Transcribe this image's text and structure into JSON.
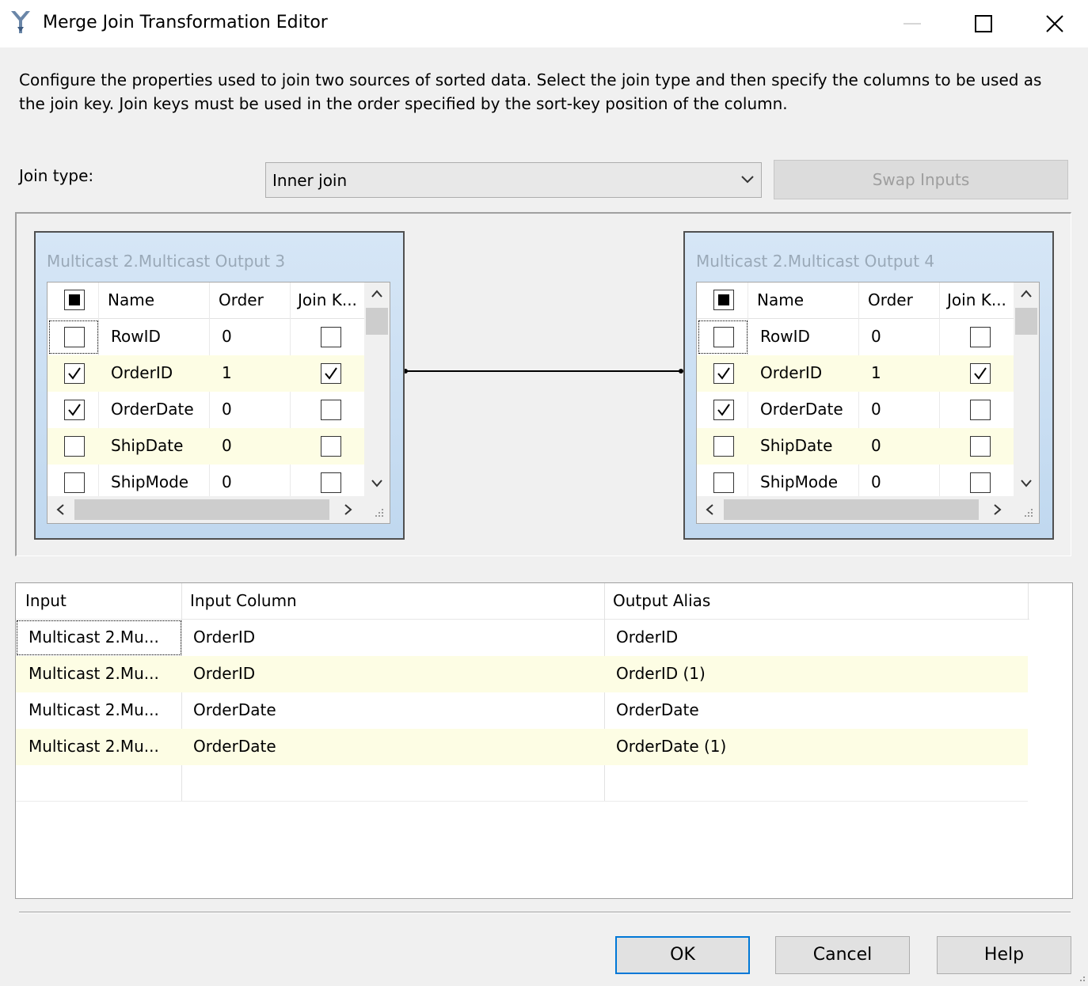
{
  "window": {
    "title": "Merge Join Transformation Editor"
  },
  "description": "Configure the properties used to join two sources of sorted data. Select the join type and then specify the columns to be used as the join key. Join keys must be used in the order specified by the sort-key position of the column.",
  "join": {
    "label": "Join type:",
    "selected": "Inner join",
    "swap_label": "Swap Inputs"
  },
  "left_input": {
    "title": "Multicast 2.Multicast Output 3",
    "headers": {
      "name": "Name",
      "order": "Order",
      "join_key": "Join K..."
    },
    "rows": [
      {
        "selected": false,
        "name": "RowID",
        "order": "0",
        "join_key": false
      },
      {
        "selected": true,
        "name": "OrderID",
        "order": "1",
        "join_key": true
      },
      {
        "selected": true,
        "name": "OrderDate",
        "order": "0",
        "join_key": false
      },
      {
        "selected": false,
        "name": "ShipDate",
        "order": "0",
        "join_key": false
      },
      {
        "selected": false,
        "name": "ShipMode",
        "order": "0",
        "join_key": false
      }
    ]
  },
  "right_input": {
    "title": "Multicast 2.Multicast Output 4",
    "headers": {
      "name": "Name",
      "order": "Order",
      "join_key": "Join K..."
    },
    "rows": [
      {
        "selected": false,
        "name": "RowID",
        "order": "0",
        "join_key": false
      },
      {
        "selected": true,
        "name": "OrderID",
        "order": "1",
        "join_key": true
      },
      {
        "selected": true,
        "name": "OrderDate",
        "order": "0",
        "join_key": false
      },
      {
        "selected": false,
        "name": "ShipDate",
        "order": "0",
        "join_key": false
      },
      {
        "selected": false,
        "name": "ShipMode",
        "order": "0",
        "join_key": false
      }
    ]
  },
  "output": {
    "headers": {
      "input": "Input",
      "input_column": "Input Column",
      "output_alias": "Output Alias"
    },
    "rows": [
      {
        "input": "Multicast 2.Mu...",
        "input_column": "OrderID",
        "output_alias": "OrderID"
      },
      {
        "input": "Multicast 2.Mu...",
        "input_column": "OrderID",
        "output_alias": "OrderID (1)"
      },
      {
        "input": "Multicast 2.Mu...",
        "input_column": "OrderDate",
        "output_alias": "OrderDate"
      },
      {
        "input": "Multicast 2.Mu...",
        "input_column": "OrderDate",
        "output_alias": "OrderDate (1)"
      }
    ]
  },
  "buttons": {
    "ok": "OK",
    "cancel": "Cancel",
    "help": "Help"
  },
  "colors": {
    "accent": "#0078d7",
    "alt_row": "#fdfde4",
    "panel_gradient_top": "#d6e6f6"
  }
}
